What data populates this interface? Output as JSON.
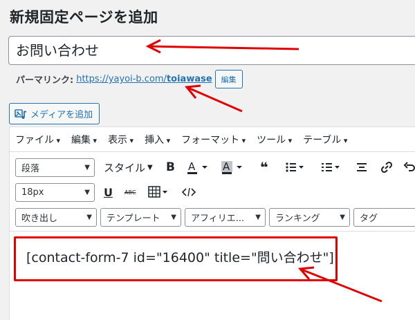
{
  "header": {
    "title": "新規固定ページを追加"
  },
  "title_field": {
    "value": "お問い合わせ"
  },
  "permalink": {
    "label": "パーマリンク:",
    "url_base": "https://yayoi-b.com/",
    "slug": "toiawase",
    "edit_label": "編集"
  },
  "media": {
    "add_label": "メディアを追加"
  },
  "menubar": {
    "items": [
      "ファイル",
      "編集",
      "表示",
      "挿入",
      "フォーマット",
      "ツール",
      "テーブル"
    ]
  },
  "toolbar": {
    "paragraph_select": "段落",
    "style_select": "スタイル",
    "fontsize_select": "18px",
    "balloon_select": "吹き出し",
    "template_select": "テンプレート",
    "affiliate_select": "アフィリエ...",
    "ranking_select": "ランキング",
    "tag_select": "タグ",
    "bold_glyph": "B",
    "underline_glyph": "U",
    "strike_glyph": "ABC"
  },
  "content": {
    "shortcode": "[contact-form-7 id=\"16400\" title=\"問い合わせ\"]"
  },
  "colors": {
    "accent": "#2271b1",
    "annotation": "#e00000"
  }
}
